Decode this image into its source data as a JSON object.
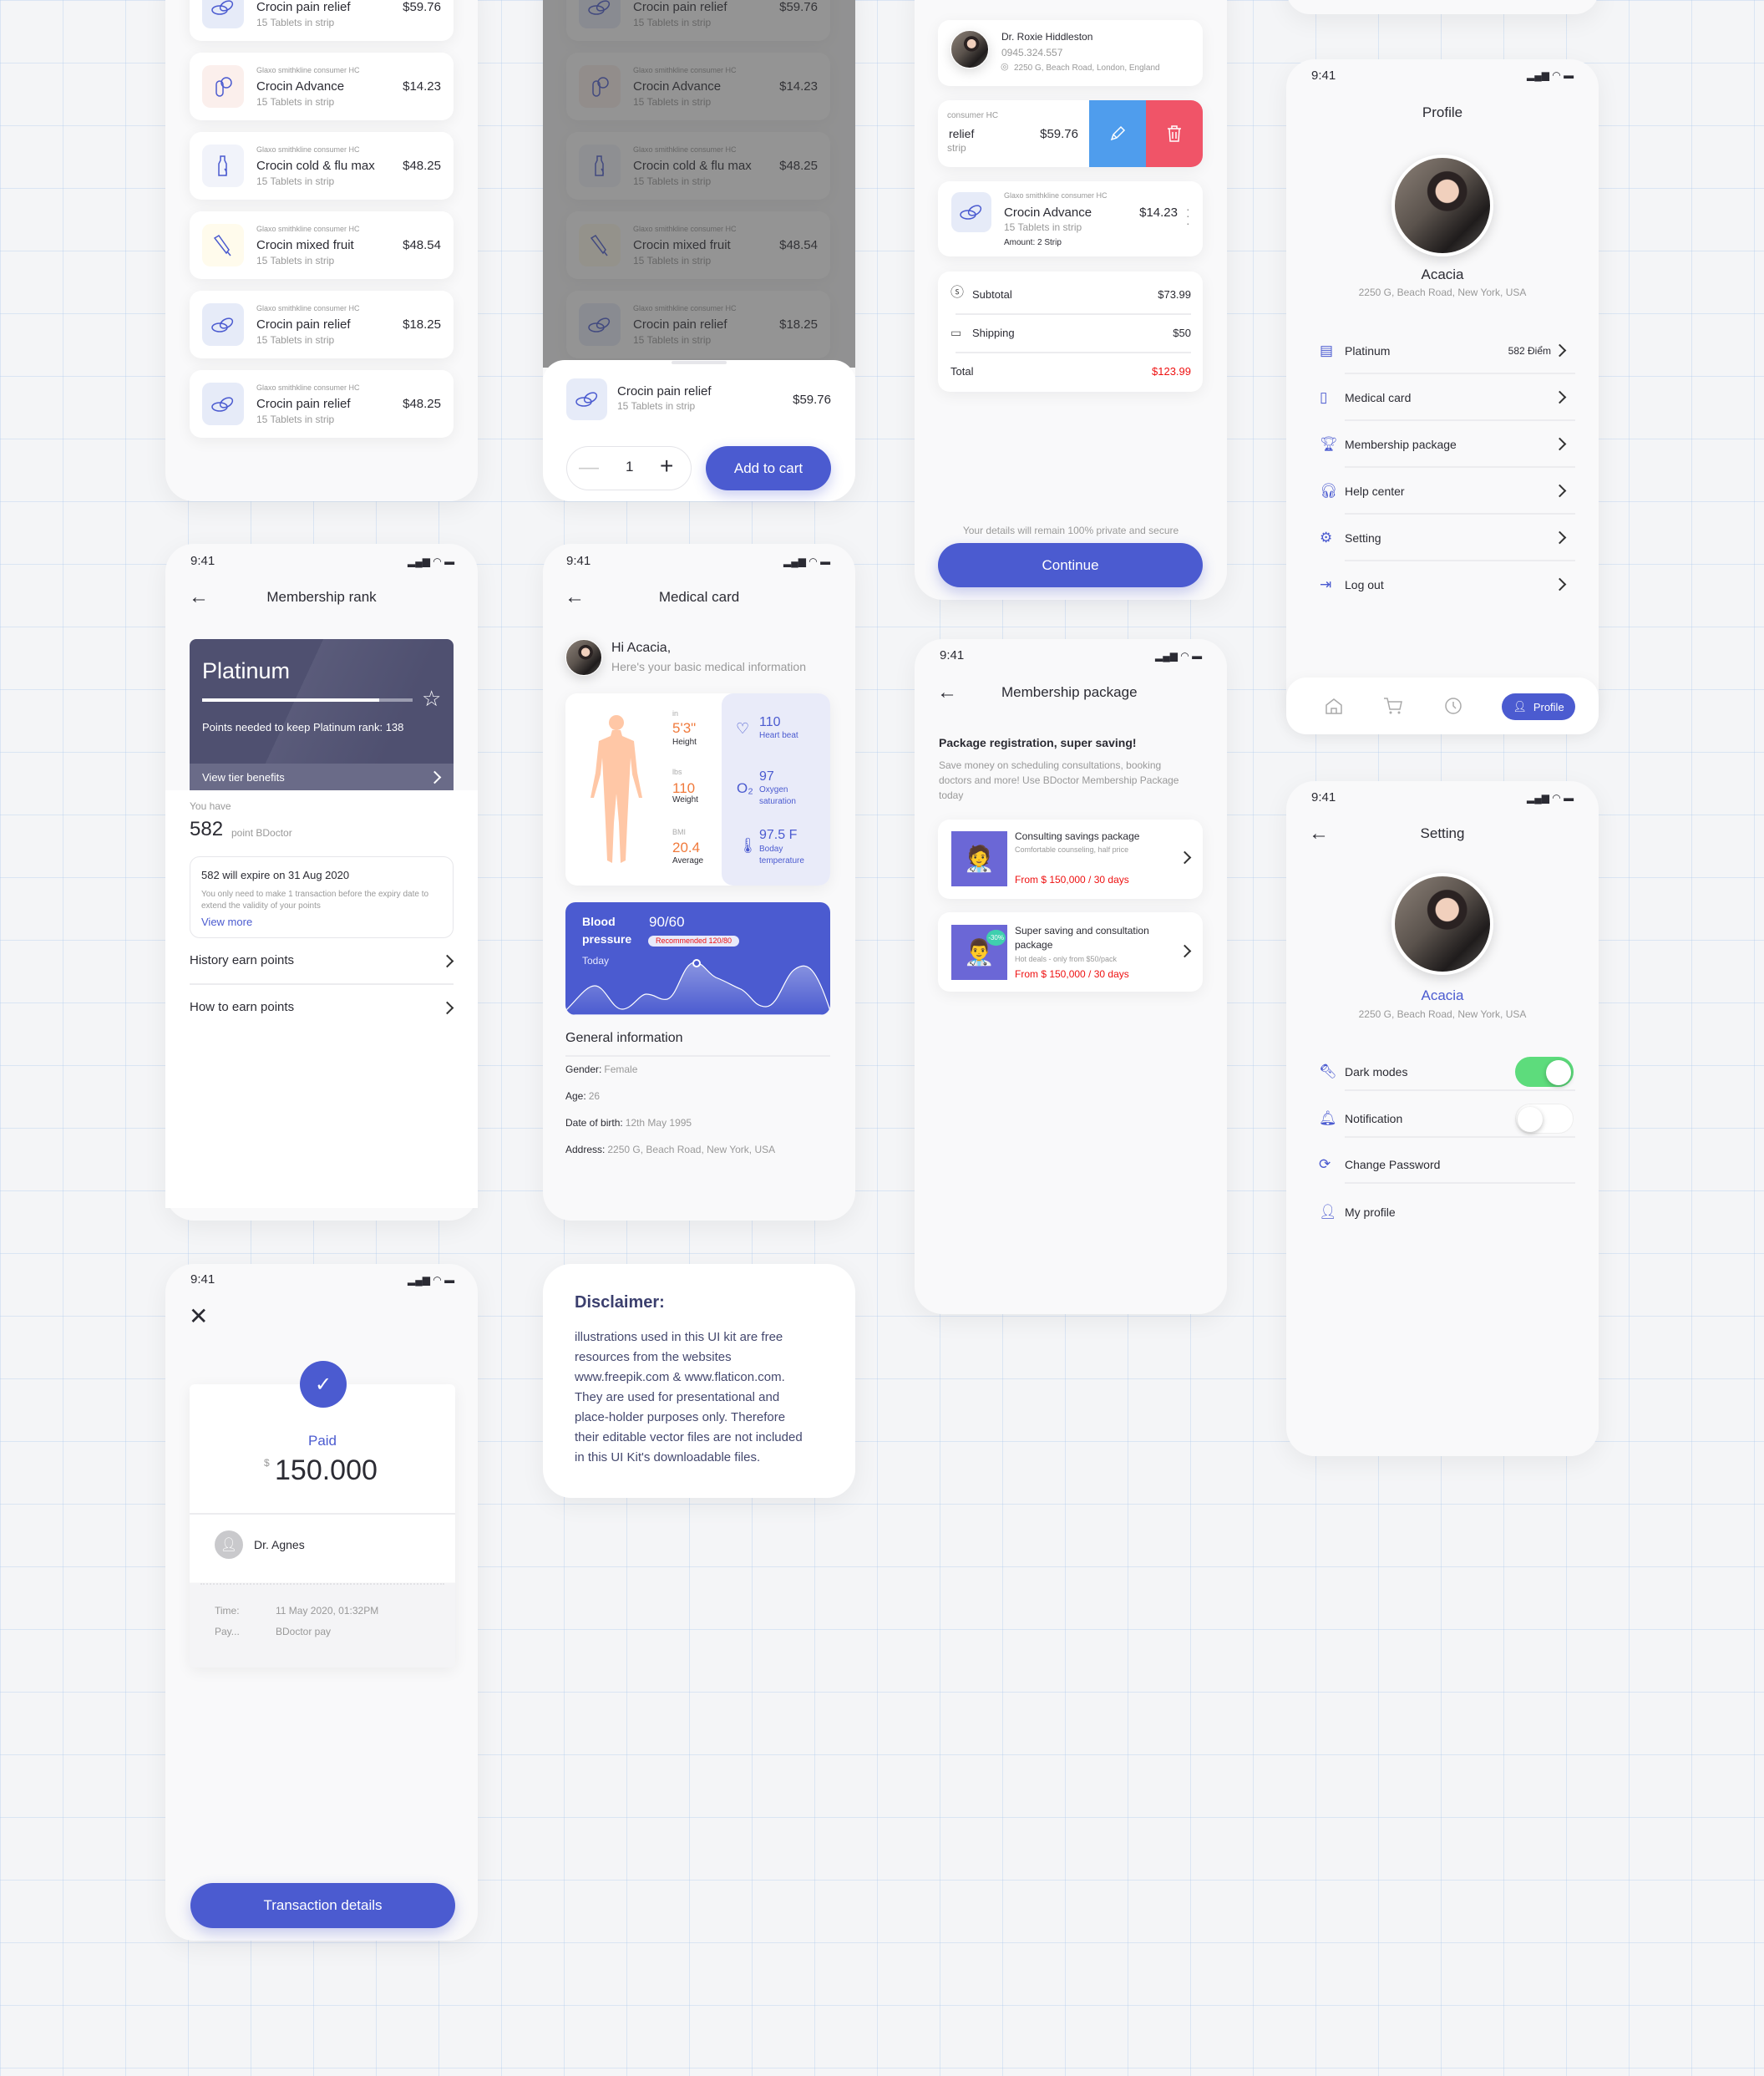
{
  "colors": {
    "accent": "#4b5bd0",
    "price_red": "#ee1111",
    "edit": "#4f9ded",
    "delete": "#f05468",
    "toggle_on": "#5ddc7c",
    "platinum_card": "#4f5070",
    "body": "#ffc7a6"
  },
  "status": {
    "time": "9:41"
  },
  "products": {
    "brand": "Glaxo smithkline consumer HC",
    "items": [
      {
        "name": "Crocin pain relief",
        "sub": "15 Tablets in strip",
        "price": "$59.76",
        "icon": "pills-icon"
      },
      {
        "name": "Crocin Advance",
        "sub": "15 Tablets in strip",
        "price": "$14.23",
        "icon": "capsule-icon"
      },
      {
        "name": "Crocin cold & flu max",
        "sub": "15 Tablets in strip",
        "price": "$48.25",
        "icon": "bottle-icon"
      },
      {
        "name": "Crocin mixed fruit",
        "sub": "15 Tablets in strip",
        "price": "$48.54",
        "icon": "tube-icon"
      },
      {
        "name": "Crocin pain relief",
        "sub": "15 Tablets in strip",
        "price": "$18.25",
        "icon": "pills-icon"
      },
      {
        "name": "Crocin pain relief",
        "sub": "15 Tablets in strip",
        "price": "$48.25",
        "icon": "pills-icon"
      }
    ]
  },
  "sheet": {
    "name": "Crocin pain relief",
    "sub": "15 Tablets in strip",
    "price": "$59.76",
    "quantity": "1",
    "add_to_cart": "Add to cart"
  },
  "cart": {
    "doctor": {
      "name": "Dr. Roxie Hiddleston",
      "phone": "0945.324.557",
      "address": "2250 G, Beach Road, London, England"
    },
    "swiped": {
      "brand": "consumer HC",
      "name": "relief",
      "sub": "strip",
      "price": "$59.76"
    },
    "item": {
      "brand": "Glaxo smithkline consumer HC",
      "name": "Crocin Advance",
      "sub": "15 Tablets in strip",
      "amount": "Amount: 2 Strip",
      "price": "$14.23"
    },
    "subtotal_label": "Subtotal",
    "subtotal": "$73.99",
    "shipping_label": "Shipping",
    "shipping": "$50",
    "total_label": "Total",
    "total": "$123.99",
    "privacy": "Your details will remain 100% private and secure",
    "continue": "Continue"
  },
  "profile": {
    "title": "Profile",
    "name": "Acacia",
    "address": "2250 G, Beach Road, New York, USA",
    "menu": [
      {
        "label": "Platinum",
        "value": "582 Điểm"
      },
      {
        "label": "Medical card"
      },
      {
        "label": "Membership package"
      },
      {
        "label": "Help center"
      },
      {
        "label": "Setting"
      },
      {
        "label": "Log out"
      }
    ],
    "nav": {
      "active": "Profile"
    }
  },
  "rank": {
    "title": "Membership rank",
    "tier": "Platinum",
    "progress": 0.84,
    "points_needed": "Points needed to keep Platinum rank: 138",
    "view_benefits": "View tier benefits",
    "you_have": "You have",
    "points": "582",
    "points_unit": "point BDoctor",
    "expire_title": "582 will expire on 31 Aug 2020",
    "expire_desc1": "You only need to make 1 transaction before the expiry date to",
    "expire_desc2": "extend the validity of your points",
    "view_more": "View more",
    "history": "History earn points",
    "how": "How to earn points"
  },
  "medical": {
    "title": "Medical card",
    "greeting": "Hi Acacia,",
    "subtitle": "Here's your basic medical information",
    "height_unit": "in",
    "height": "5'3\"",
    "height_label": "Height",
    "weight_unit": "lbs",
    "weight": "110",
    "weight_label": "Weight",
    "bmi_unit": "BMI",
    "bmi": "20.4",
    "bmi_label": "Average",
    "heart": "110",
    "heart_label": "Heart beat",
    "oxygen": "97",
    "oxygen_label1": "Oxygen",
    "oxygen_label2": "saturation",
    "temp": "97.5 F",
    "temp_label1": "Boday",
    "temp_label2": "temperature",
    "bp_label1": "Blood",
    "bp_label2": "pressure",
    "bp_value": "90/60",
    "bp_recommended": "Recommended 120/80",
    "bp_today": "Today",
    "general_title": "General information",
    "info": [
      {
        "k": "Gender:",
        "v": "Female"
      },
      {
        "k": "Age:",
        "v": "26"
      },
      {
        "k": "Date of birth:",
        "v": "12th May 1995"
      },
      {
        "k": "Address:",
        "v": "2250 G, Beach Road, New York, USA"
      }
    ]
  },
  "package": {
    "title": "Membership package",
    "heading": "Package registration, super saving!",
    "desc1": "Save money on scheduling consultations, booking",
    "desc2": "doctors and more! Use BDoctor Membership Package",
    "desc3": "today",
    "items": [
      {
        "title1": "Consulting savings package",
        "sub": "Comfortable counseling, half price",
        "price": "From $ 150,000 / 30 days"
      },
      {
        "title1": "Super saving and consultation",
        "title2": "package",
        "sub": "Hot deals - only from $50/pack",
        "price": "From $ 150,000 / 30 days",
        "badge": "-30%"
      }
    ]
  },
  "setting": {
    "title": "Setting",
    "name": "Acacia",
    "address": "2250 G, Beach Road, New York, USA",
    "rows": [
      {
        "label": "Dark modes",
        "toggle": true
      },
      {
        "label": "Notification",
        "toggle": false
      },
      {
        "label": "Change Password"
      },
      {
        "label": "My profile"
      }
    ]
  },
  "payment": {
    "status": "Paid",
    "currency": "$",
    "amount": "150.000",
    "doctor": "Dr. Agnes",
    "time_label": "Time:",
    "time": "11 May 2020, 01:32PM",
    "pay_label": "Pay...",
    "pay": "BDoctor pay",
    "details": "Transaction details"
  },
  "disclaimer": {
    "title": "Disclaimer:",
    "lines": [
      "illustrations used in this UI kit are free",
      "resources from the websites",
      "www.freepik.com & www.flaticon.com.",
      "They are used for presentational and",
      "place-holder purposes only. Therefore",
      "their editable vector files are not included",
      "in this UI Kit's downloadable files."
    ]
  }
}
